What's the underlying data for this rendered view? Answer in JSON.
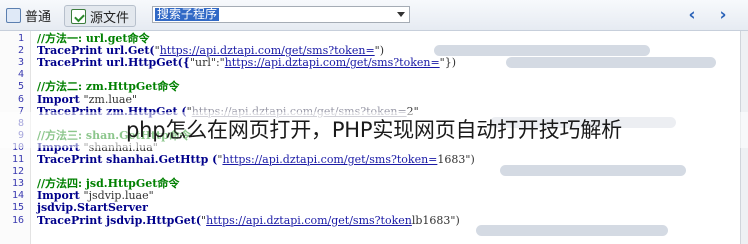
{
  "toolbar": {
    "normal_label": "普通",
    "source_label": "源文件",
    "search_value": "搜索子程序",
    "prev_glyph": "‹",
    "next_glyph": "›"
  },
  "editor": {
    "lines": [
      {
        "n": "1",
        "comment": "//方法一: url.get命令"
      },
      {
        "n": "2",
        "kw": "TracePrint url.Get(",
        "str": "\"",
        "url": "https://api.dztapi.com/get/sms?token=",
        "tail": "\")"
      },
      {
        "n": "3",
        "kw": "TracePrint url.HttpGet({",
        "str": "\"url\":\"",
        "url": "https://api.dztapi.com/get/sms?token=",
        "tail": "\"})"
      },
      {
        "n": "4"
      },
      {
        "n": "5",
        "comment": "//方法二: zm.HttpGet命令"
      },
      {
        "n": "6",
        "kw": "Import ",
        "str": "\"zm.luae\""
      },
      {
        "n": "7",
        "kw": "TracePrint zm.HttpGet (",
        "str": "\"",
        "dim": "https://api.dztapi.com/get/sms?token=",
        "tail": "2\""
      },
      {
        "n": "8"
      },
      {
        "n": "9",
        "comment": "//方法三: shan.GetHttp命令"
      },
      {
        "n": "10",
        "kw": "Import ",
        "str": "\"shanhai.lua\""
      },
      {
        "n": "11",
        "kw": "TracePrint shanhai.GetHttp (",
        "str": "\"",
        "url": "https://api.dztapi.com/get/sms?token=",
        "tail": "1683\")"
      },
      {
        "n": "12"
      },
      {
        "n": "13",
        "comment": "//方法四: jsd.HttpGet命令"
      },
      {
        "n": "14",
        "kw": "Import ",
        "str": "\"jsdvip.luae\""
      },
      {
        "n": "15",
        "kw": "jsdvip.StartServer"
      },
      {
        "n": "16",
        "kw": "TracePrint jsdvip.HttpGet(",
        "str": "\"",
        "url": "https://api.dztapi.com/get/sms?token",
        "tail": "lb1683\")"
      }
    ]
  },
  "overlay_title": "php怎么在网页打开，PHP实现网页自动打开技巧解析"
}
